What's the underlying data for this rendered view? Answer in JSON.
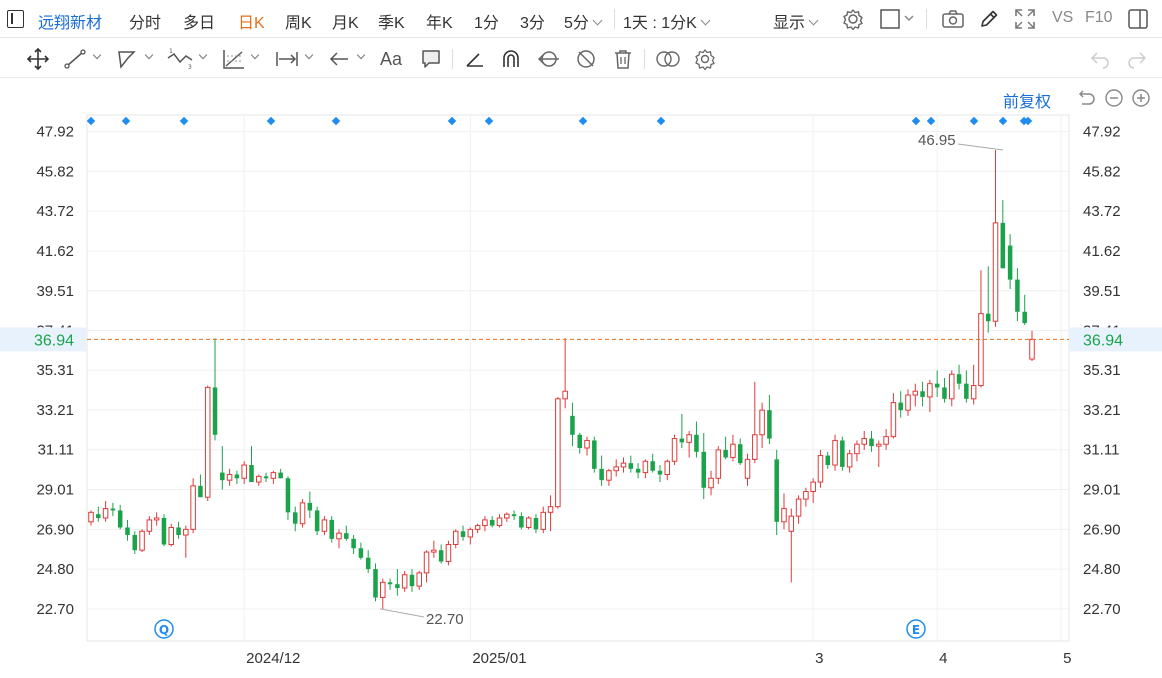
{
  "header": {
    "stock_name": "远翔新材",
    "periods": [
      "分时",
      "多日",
      "日K",
      "周K",
      "月K",
      "季K",
      "年K",
      "1分",
      "3分",
      "5分"
    ],
    "active_period": "日K",
    "interval_selector": "1天 : 1分K",
    "display_label": "显示",
    "vs_label": "VS",
    "f10_label": "F10"
  },
  "toolbar": {
    "text_tool_label": "Aa"
  },
  "adjust": {
    "label": "前复权"
  },
  "colors": {
    "up": "#e03a3a",
    "down": "#1aa34a",
    "accent": "#1a6ed8",
    "price_line": "#e5701a",
    "marker": "#1f8cf0"
  },
  "chart_data": {
    "type": "candlestick",
    "ylim": [
      21.0,
      48.8
    ],
    "y_ticks": [
      "47.92",
      "45.82",
      "43.72",
      "41.62",
      "39.51",
      "37.41",
      "35.31",
      "33.21",
      "31.11",
      "29.01",
      "26.90",
      "24.80",
      "22.70"
    ],
    "x_tick_labels": [
      "2024/12",
      "2025/01",
      "3",
      "4",
      "5"
    ],
    "current_price": "36.94",
    "high_annotation": "46.95",
    "low_annotation": "22.70",
    "event_badges": [
      "Q",
      "E"
    ],
    "ohlc": [
      [
        27.3,
        27.9,
        27.1,
        27.8
      ],
      [
        27.7,
        28.1,
        27.3,
        27.5
      ],
      [
        27.5,
        28.4,
        27.3,
        28.0
      ],
      [
        28.0,
        28.3,
        27.6,
        27.9
      ],
      [
        27.9,
        28.2,
        26.9,
        27.0
      ],
      [
        27.0,
        27.4,
        26.3,
        26.6
      ],
      [
        26.6,
        26.8,
        25.6,
        25.8
      ],
      [
        25.8,
        26.9,
        25.7,
        26.8
      ],
      [
        26.8,
        27.6,
        26.6,
        27.4
      ],
      [
        27.4,
        27.8,
        27.1,
        27.5
      ],
      [
        27.5,
        27.7,
        26.0,
        26.1
      ],
      [
        26.1,
        27.2,
        26.0,
        27.0
      ],
      [
        27.0,
        27.3,
        26.4,
        26.6
      ],
      [
        26.6,
        27.1,
        25.4,
        26.9
      ],
      [
        26.9,
        29.6,
        26.7,
        29.2
      ],
      [
        29.2,
        29.8,
        28.6,
        28.6
      ],
      [
        28.6,
        34.5,
        28.4,
        34.4
      ],
      [
        34.4,
        37.0,
        31.6,
        31.9
      ],
      [
        29.9,
        31.3,
        29.0,
        29.5
      ],
      [
        29.5,
        30.1,
        29.2,
        29.8
      ],
      [
        29.8,
        30.0,
        29.3,
        29.6
      ],
      [
        29.6,
        30.5,
        29.3,
        30.3
      ],
      [
        30.3,
        31.3,
        29.4,
        29.4
      ],
      [
        29.4,
        29.8,
        29.2,
        29.7
      ],
      [
        29.7,
        29.9,
        29.4,
        29.6
      ],
      [
        29.6,
        30.0,
        29.3,
        29.9
      ],
      [
        29.9,
        30.1,
        29.6,
        29.6
      ],
      [
        29.6,
        29.7,
        27.4,
        27.8
      ],
      [
        27.8,
        28.1,
        26.8,
        27.2
      ],
      [
        27.2,
        28.5,
        27.0,
        28.3
      ],
      [
        28.3,
        28.9,
        27.5,
        27.9
      ],
      [
        27.9,
        28.1,
        26.6,
        26.8
      ],
      [
        26.8,
        27.6,
        26.6,
        27.4
      ],
      [
        27.4,
        27.6,
        26.2,
        26.4
      ],
      [
        26.4,
        26.9,
        25.9,
        26.7
      ],
      [
        26.7,
        27.1,
        26.3,
        26.4
      ],
      [
        26.4,
        26.6,
        25.6,
        25.9
      ],
      [
        25.9,
        26.2,
        25.3,
        25.4
      ],
      [
        25.4,
        25.8,
        24.6,
        24.8
      ],
      [
        24.8,
        25.1,
        23.1,
        23.3
      ],
      [
        23.3,
        24.3,
        22.7,
        24.1
      ],
      [
        24.1,
        24.3,
        23.7,
        24.0
      ],
      [
        24.0,
        24.8,
        23.4,
        23.8
      ],
      [
        23.8,
        24.7,
        23.6,
        24.5
      ],
      [
        24.5,
        24.8,
        23.6,
        23.9
      ],
      [
        23.9,
        24.7,
        23.7,
        24.6
      ],
      [
        24.6,
        25.8,
        24.1,
        25.7
      ],
      [
        25.7,
        26.3,
        25.4,
        25.8
      ],
      [
        25.8,
        26.1,
        25.1,
        25.2
      ],
      [
        25.2,
        26.3,
        25.0,
        26.1
      ],
      [
        26.1,
        26.9,
        25.9,
        26.8
      ],
      [
        26.8,
        27.1,
        26.3,
        26.5
      ],
      [
        26.5,
        27.0,
        26.1,
        26.9
      ],
      [
        26.9,
        27.2,
        26.7,
        27.1
      ],
      [
        27.1,
        27.6,
        26.8,
        27.4
      ],
      [
        27.4,
        27.6,
        27.0,
        27.1
      ],
      [
        27.1,
        27.7,
        27.0,
        27.5
      ],
      [
        27.5,
        27.8,
        27.3,
        27.7
      ],
      [
        27.7,
        27.9,
        27.4,
        27.6
      ],
      [
        27.6,
        27.8,
        26.9,
        27.0
      ],
      [
        27.0,
        27.6,
        26.9,
        27.5
      ],
      [
        27.5,
        27.7,
        26.7,
        26.9
      ],
      [
        26.9,
        28.1,
        26.7,
        27.8
      ],
      [
        27.8,
        28.7,
        26.8,
        28.1
      ],
      [
        28.1,
        33.9,
        28.0,
        33.8
      ],
      [
        33.8,
        37.0,
        33.3,
        34.2
      ],
      [
        32.9,
        33.6,
        31.3,
        31.9
      ],
      [
        31.9,
        32.0,
        30.9,
        31.2
      ],
      [
        31.2,
        31.8,
        30.8,
        31.6
      ],
      [
        31.6,
        31.8,
        29.9,
        30.1
      ],
      [
        30.1,
        30.8,
        29.2,
        29.5
      ],
      [
        29.5,
        30.1,
        29.2,
        30.0
      ],
      [
        30.0,
        30.6,
        29.7,
        30.2
      ],
      [
        30.2,
        30.7,
        29.9,
        30.4
      ],
      [
        30.4,
        30.8,
        29.9,
        30.1
      ],
      [
        30.1,
        30.4,
        29.6,
        29.9
      ],
      [
        29.9,
        30.6,
        29.6,
        30.5
      ],
      [
        30.5,
        30.9,
        29.9,
        30.0
      ],
      [
        30.0,
        30.3,
        29.4,
        29.8
      ],
      [
        29.8,
        30.6,
        29.5,
        30.5
      ],
      [
        30.5,
        31.9,
        30.3,
        31.7
      ],
      [
        31.7,
        33.0,
        31.2,
        31.5
      ],
      [
        31.5,
        32.1,
        30.7,
        31.9
      ],
      [
        31.9,
        32.6,
        30.7,
        31.0
      ],
      [
        31.0,
        32.0,
        28.5,
        29.1
      ],
      [
        29.1,
        30.0,
        28.7,
        29.6
      ],
      [
        29.6,
        31.3,
        29.3,
        31.1
      ],
      [
        31.1,
        31.8,
        30.6,
        30.7
      ],
      [
        30.7,
        31.9,
        30.5,
        31.4
      ],
      [
        31.4,
        31.7,
        30.3,
        30.4
      ],
      [
        29.6,
        30.9,
        29.2,
        30.6
      ],
      [
        30.6,
        34.7,
        30.4,
        31.9
      ],
      [
        31.9,
        33.6,
        31.2,
        33.2
      ],
      [
        33.2,
        34.0,
        31.4,
        31.7
      ],
      [
        30.6,
        31.1,
        26.6,
        27.3
      ],
      [
        27.3,
        28.8,
        26.9,
        28.0
      ],
      [
        26.8,
        28.0,
        24.1,
        27.6
      ],
      [
        27.6,
        28.7,
        27.2,
        28.5
      ],
      [
        28.5,
        29.1,
        28.1,
        28.9
      ],
      [
        28.9,
        29.6,
        28.3,
        29.4
      ],
      [
        29.4,
        31.1,
        29.1,
        30.8
      ],
      [
        30.8,
        31.0,
        30.1,
        30.3
      ],
      [
        30.3,
        31.9,
        30.0,
        31.6
      ],
      [
        31.6,
        31.8,
        30.0,
        30.2
      ],
      [
        30.2,
        31.1,
        29.9,
        30.9
      ],
      [
        30.9,
        31.6,
        30.5,
        31.4
      ],
      [
        31.4,
        32.1,
        31.1,
        31.7
      ],
      [
        31.7,
        32.1,
        31.0,
        31.3
      ],
      [
        31.3,
        31.6,
        30.2,
        31.4
      ],
      [
        31.4,
        32.2,
        31.1,
        31.8
      ],
      [
        31.8,
        34.1,
        31.7,
        33.6
      ],
      [
        33.6,
        34.2,
        32.8,
        33.2
      ],
      [
        33.2,
        34.3,
        32.9,
        34.0
      ],
      [
        34.0,
        34.6,
        33.4,
        34.2
      ],
      [
        34.2,
        34.7,
        33.4,
        33.9
      ],
      [
        33.9,
        34.8,
        33.1,
        34.6
      ],
      [
        34.6,
        35.3,
        33.9,
        34.4
      ],
      [
        34.4,
        34.9,
        33.6,
        33.8
      ],
      [
        33.8,
        35.3,
        33.4,
        35.1
      ],
      [
        35.1,
        35.6,
        34.3,
        34.6
      ],
      [
        34.6,
        35.3,
        33.6,
        33.8
      ],
      [
        33.8,
        35.6,
        33.5,
        34.5
      ],
      [
        34.5,
        40.6,
        34.4,
        38.3
      ],
      [
        38.3,
        40.8,
        37.3,
        37.9
      ],
      [
        37.9,
        46.95,
        37.6,
        43.1
      ],
      [
        43.1,
        44.3,
        40.7,
        40.7
      ],
      [
        41.9,
        42.5,
        39.6,
        40.1
      ],
      [
        40.1,
        40.7,
        37.9,
        38.4
      ],
      [
        38.4,
        39.3,
        37.7,
        37.8
      ],
      [
        35.9,
        37.4,
        35.8,
        36.94
      ]
    ],
    "markers_count": 15
  }
}
